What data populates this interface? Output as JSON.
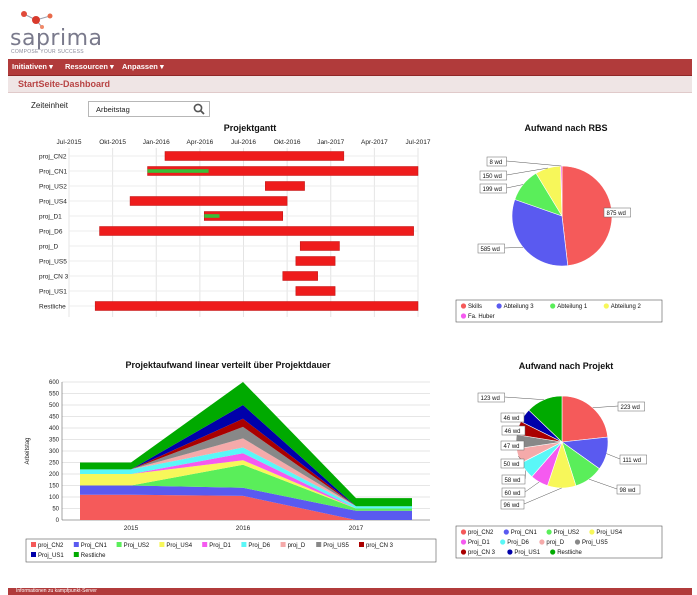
{
  "brand": {
    "name": "saprima",
    "tagline": "COMPOSE YOUR SUCCESS"
  },
  "colors": {
    "menu": "#b13b3b",
    "accent": "#b84444"
  },
  "menu": {
    "items": [
      "Initiativen",
      "Ressourcen",
      "Anpassen"
    ]
  },
  "page": {
    "title": "StartSeite-Dashboard"
  },
  "filter": {
    "label": "Zeiteinheit",
    "value": "Arbeitstag",
    "icon": "search-icon"
  },
  "footer": {
    "text": "Informationen zu kampfpunkt-Server"
  },
  "chart_data": [
    {
      "type": "gantt",
      "title": "Projektgantt",
      "x_ticks": [
        "Jul-2015",
        "Okt-2015",
        "Jan-2016",
        "Apr-2016",
        "Jul-2016",
        "Okt-2016",
        "Jan-2017",
        "Apr-2017",
        "Jul-2017"
      ],
      "grid": true,
      "rows": [
        {
          "name": "proj_CN2",
          "start": 2.2,
          "end": 6.3
        },
        {
          "name": "Proj_CN1",
          "start": 1.8,
          "end": 8.0,
          "progress_start": 1.8,
          "progress_end": 3.2
        },
        {
          "name": "Proj_US2",
          "start": 4.5,
          "end": 5.4
        },
        {
          "name": "Proj_US4",
          "start": 1.4,
          "end": 5.0
        },
        {
          "name": "proj_D1",
          "start": 3.1,
          "end": 4.9,
          "progress_start": 3.1,
          "progress_end": 3.45
        },
        {
          "name": "Proj_D6",
          "start": 0.7,
          "end": 7.9
        },
        {
          "name": "proj_D",
          "start": 5.3,
          "end": 6.2
        },
        {
          "name": "Proj_US5",
          "start": 5.2,
          "end": 6.1
        },
        {
          "name": "proj_CN 3",
          "start": 4.9,
          "end": 5.7
        },
        {
          "name": "Proj_US1",
          "start": 5.2,
          "end": 6.1
        },
        {
          "name": "Restliche",
          "start": 0.6,
          "end": 8.0
        }
      ]
    },
    {
      "type": "pie",
      "title": "Aufwand nach RBS",
      "slices": [
        {
          "name": "Skills",
          "value": 875,
          "label": "875 wd",
          "color": "#f55a5a"
        },
        {
          "name": "Abteilung 3",
          "value": 585,
          "label": "585 wd",
          "color": "#5a5af0"
        },
        {
          "name": "Abteilung 1",
          "value": 199,
          "label": "199 wd",
          "color": "#5aee5a"
        },
        {
          "name": "Abteilung 2",
          "value": 150,
          "label": "150 wd",
          "color": "#f7f75a"
        },
        {
          "name": "Fa. Huber",
          "value": 8,
          "label": "8 wd",
          "color": "#f55af0"
        }
      ],
      "legend": "bottom"
    },
    {
      "type": "area",
      "title": "Projektaufwand linear verteilt über Projektdauer",
      "categories": [
        "2015",
        "2016",
        "2017"
      ],
      "ylabel": "Arbeitstag",
      "ylim": [
        0,
        600
      ],
      "y_ticks": [
        "0",
        "50",
        "100",
        "150",
        "200",
        "250",
        "300",
        "350",
        "400",
        "450",
        "500",
        "550",
        "600"
      ],
      "series": [
        {
          "name": "proj_CN2",
          "color": "#f55a5a",
          "values": [
            110,
            105,
            0
          ]
        },
        {
          "name": "Proj_CN1",
          "color": "#5a5af0",
          "values": [
            40,
            35,
            40
          ]
        },
        {
          "name": "Proj_US2",
          "color": "#5aee5a",
          "values": [
            0,
            100,
            10
          ]
        },
        {
          "name": "Proj_US4",
          "color": "#f7f75a",
          "values": [
            50,
            20,
            0
          ]
        },
        {
          "name": "Proj_D1",
          "color": "#f55af0",
          "values": [
            0,
            30,
            0
          ]
        },
        {
          "name": "Proj_D6",
          "color": "#5af7f7",
          "values": [
            20,
            25,
            10
          ]
        },
        {
          "name": "proj_D",
          "color": "#f5aaaa",
          "values": [
            0,
            40,
            0
          ]
        },
        {
          "name": "Proj_US5",
          "color": "#888888",
          "values": [
            0,
            50,
            0
          ]
        },
        {
          "name": "proj_CN 3",
          "color": "#aa0000",
          "values": [
            0,
            35,
            0
          ]
        },
        {
          "name": "Proj_US1",
          "color": "#0000aa",
          "values": [
            0,
            60,
            0
          ]
        },
        {
          "name": "Restliche",
          "color": "#00aa00",
          "values": [
            30,
            100,
            35
          ]
        }
      ],
      "legend": "bottom"
    },
    {
      "type": "pie",
      "title": "Aufwand nach Projekt",
      "slices": [
        {
          "name": "proj_CN2",
          "value": 223,
          "label": "223 wd",
          "color": "#f55a5a"
        },
        {
          "name": "Proj_CN1",
          "value": 111,
          "label": "111 wd",
          "color": "#5a5af0"
        },
        {
          "name": "Proj_US2",
          "value": 98,
          "label": "98 wd",
          "color": "#5aee5a"
        },
        {
          "name": "Proj_US4",
          "value": 96,
          "label": "96 wd",
          "color": "#f7f75a"
        },
        {
          "name": "Proj_D1",
          "value": 60,
          "label": "60 wd",
          "color": "#f55af0"
        },
        {
          "name": "Proj_D6",
          "value": 58,
          "label": "58 wd",
          "color": "#5af7f7"
        },
        {
          "name": "proj_D",
          "value": 50,
          "label": "50 wd",
          "color": "#f5aaaa"
        },
        {
          "name": "Proj_US5",
          "value": 47,
          "label": "47 wd",
          "color": "#888888"
        },
        {
          "name": "proj_CN 3",
          "value": 46,
          "label": "46 wd",
          "color": "#aa0000"
        },
        {
          "name": "Proj_US1",
          "value": 46,
          "label": "46 wd",
          "color": "#0000aa"
        },
        {
          "name": "Restliche",
          "value": 123,
          "label": "123 wd",
          "color": "#00aa00"
        }
      ],
      "legend": "bottom"
    }
  ]
}
